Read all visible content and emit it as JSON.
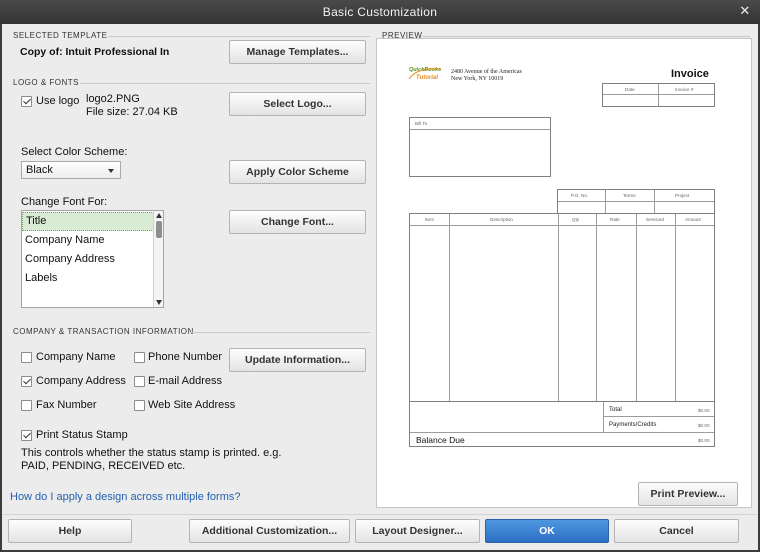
{
  "window": {
    "title": "Basic Customization",
    "close_glyph": "✕"
  },
  "selected_template": {
    "section_label": "SELECTED TEMPLATE",
    "value": "Copy of: Intuit Professional In",
    "manage_button": "Manage Templates..."
  },
  "logo_fonts": {
    "section_label": "LOGO & FONTS",
    "use_logo_label": "Use logo",
    "use_logo_checked": true,
    "logo_file": "logo2.PNG",
    "file_size": "File size: 27.04 KB",
    "select_logo_button": "Select Logo...",
    "color_scheme_label": "Select Color Scheme:",
    "color_scheme_value": "Black",
    "apply_scheme_button": "Apply Color Scheme",
    "change_font_for_label": "Change Font For:",
    "font_items": [
      "Title",
      "Company Name",
      "Company Address",
      "Labels"
    ],
    "selected_font_item": "Title",
    "change_font_button": "Change Font..."
  },
  "company_info": {
    "section_label": "COMPANY & TRANSACTION INFORMATION",
    "options": [
      {
        "label": "Company Name",
        "checked": false
      },
      {
        "label": "Phone Number",
        "checked": false
      },
      {
        "label": "Company Address",
        "checked": true
      },
      {
        "label": "E-mail Address",
        "checked": false
      },
      {
        "label": "Fax Number",
        "checked": false
      },
      {
        "label": "Web Site Address",
        "checked": false
      }
    ],
    "update_button": "Update Information...",
    "print_status_label": "Print Status Stamp",
    "print_status_checked": true,
    "status_note_line1": "This controls whether the status stamp is printed. e.g.",
    "status_note_line2": "PAID, PENDING, RECEIVED etc."
  },
  "help_link": "How do I apply a design across multiple forms?",
  "preview": {
    "section_label": "PREVIEW",
    "print_preview_button": "Print Preview...",
    "invoice": {
      "logo_line1": "QuickBooks",
      "logo_line2": "Tutorial",
      "address_line1": "2480 Avenue of the Americas",
      "address_line2": "New York, NY 10019",
      "title": "Invoice",
      "date_label": "Date",
      "invoice_no_label": "Invoice #",
      "bill_to_label": "Bill To",
      "po_label": "P.O. No.",
      "terms_label": "Terms",
      "project_label": "Project",
      "columns": [
        "Item",
        "Description",
        "Qty",
        "Rate",
        "Serviced",
        "Amount"
      ],
      "total_label": "Total",
      "payments_label": "Payments/Credits",
      "balance_label": "Balance Due",
      "placeholder_amount": "$0.00"
    },
    "colors": {
      "logo_green": "#5a8f1e",
      "logo_orange": "#e8891a"
    }
  },
  "footer": {
    "help_button": "Help",
    "additional_button": "Additional Customization...",
    "layout_button": "Layout Designer...",
    "ok_button": "OK",
    "cancel_button": "Cancel"
  },
  "colors": {
    "accent": "#2b6fc4",
    "link": "#2561b0",
    "selected_item_bg": "#d9ebd4"
  }
}
